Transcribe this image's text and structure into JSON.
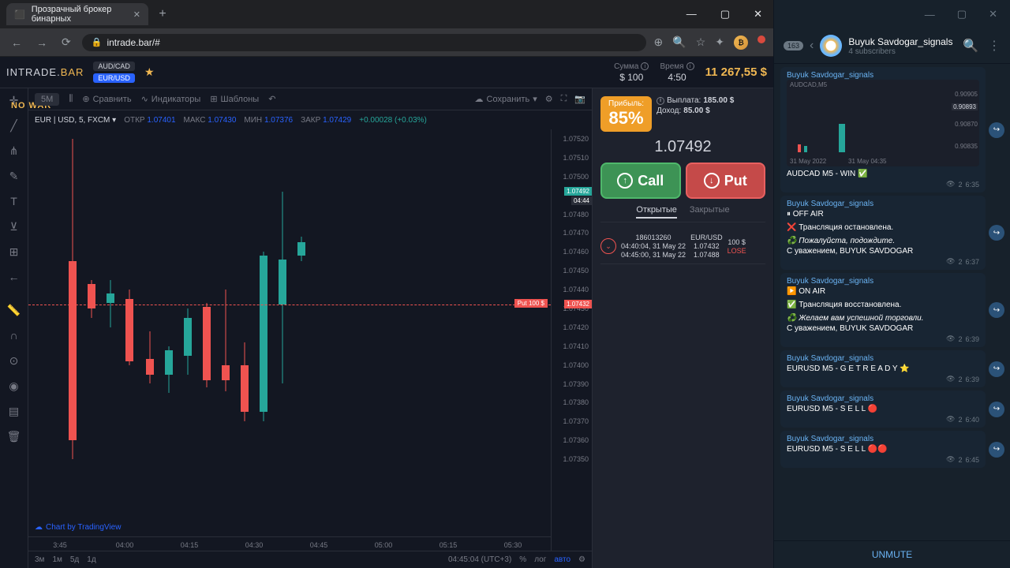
{
  "browser": {
    "tab_title": "Прозрачный брокер бинарных",
    "url": "intrade.bar/#"
  },
  "site": {
    "logo_a": "INTRADE",
    "logo_b": "BAR",
    "nowar": "NO WAR",
    "pairs": {
      "aud": "AUD/CAD",
      "eur": "EUR/USD"
    },
    "hdr": {
      "sum_lbl": "Сумма",
      "sum_val": "$   100",
      "time_lbl": "Время",
      "time_val": "4:50",
      "balance": "11 267,55 $"
    },
    "toolbar": {
      "tf": "5М",
      "compare": "Сравнить",
      "indicators": "Индикаторы",
      "templates": "Шаблоны",
      "save": "Сохранить"
    },
    "ticker": {
      "sym": "EUR | USD, 5, FXCM",
      "o_lbl": "ОТКР",
      "o": "1.07401",
      "h_lbl": "МАКС",
      "h": "1.07430",
      "l_lbl": "МИН",
      "l": "1.07376",
      "c_lbl": "ЗАКР",
      "c": "1.07429",
      "chg": "+0.00028 (+0.03%)"
    },
    "chart_footer": {
      "tf3m": "3м",
      "tf1m": "1м",
      "tf5d": "5д",
      "tf1d": "1д",
      "time": "04:45:04 (UTC+3)",
      "pct": "%",
      "log": "лог",
      "auto": "авто"
    },
    "tv_credit": "Chart by TradingView",
    "price_tags": {
      "cur": "1.07492",
      "mid": "04:44",
      "put_lbl": "Put",
      "put_amt": "100 $",
      "put_px": "1.07432"
    }
  },
  "chart_data": {
    "type": "candlestick",
    "symbol": "EUR/USD",
    "timeframe": "5m",
    "y_ticks": [
      "1.07520",
      "1.07510",
      "1.07500",
      "1.07480",
      "1.07470",
      "1.07460",
      "1.07450",
      "1.07440",
      "1.07430",
      "1.07420",
      "1.07410",
      "1.07400",
      "1.07390",
      "1.07380",
      "1.07370",
      "1.07360",
      "1.07350"
    ],
    "x_ticks": [
      "3:45",
      "04:00",
      "04:15",
      "04:30",
      "04:45",
      "05:00",
      "05:15",
      "05:30"
    ],
    "candles": [
      {
        "x": 48,
        "o": 1.07455,
        "h": 1.0752,
        "l": 1.0735,
        "c": 1.0736,
        "dir": "red"
      },
      {
        "x": 72,
        "o": 1.07443,
        "h": 1.07445,
        "l": 1.07425,
        "c": 1.0743,
        "dir": "red"
      },
      {
        "x": 96,
        "o": 1.07433,
        "h": 1.07445,
        "l": 1.0742,
        "c": 1.07438,
        "dir": "green"
      },
      {
        "x": 120,
        "o": 1.07435,
        "h": 1.0744,
        "l": 1.074,
        "c": 1.07402,
        "dir": "red"
      },
      {
        "x": 146,
        "o": 1.07403,
        "h": 1.07418,
        "l": 1.0739,
        "c": 1.07395,
        "dir": "red"
      },
      {
        "x": 170,
        "o": 1.07395,
        "h": 1.0741,
        "l": 1.07385,
        "c": 1.07408,
        "dir": "green"
      },
      {
        "x": 194,
        "o": 1.07405,
        "h": 1.0743,
        "l": 1.07395,
        "c": 1.07425,
        "dir": "green"
      },
      {
        "x": 218,
        "o": 1.07431,
        "h": 1.07433,
        "l": 1.07388,
        "c": 1.07392,
        "dir": "red"
      },
      {
        "x": 242,
        "o": 1.07392,
        "h": 1.0744,
        "l": 1.07386,
        "c": 1.074,
        "dir": "red"
      },
      {
        "x": 266,
        "o": 1.074,
        "h": 1.07412,
        "l": 1.0737,
        "c": 1.07375,
        "dir": "red"
      },
      {
        "x": 290,
        "o": 1.07375,
        "h": 1.0746,
        "l": 1.0737,
        "c": 1.07458,
        "dir": "green"
      },
      {
        "x": 314,
        "o": 1.07456,
        "h": 1.07492,
        "l": 1.0739,
        "c": 1.07432,
        "dir": "green"
      },
      {
        "x": 338,
        "o": 1.07458,
        "h": 1.07468,
        "l": 1.07455,
        "c": 1.07465,
        "dir": "green"
      }
    ],
    "ylim": [
      1.07345,
      1.07525
    ],
    "put_line": 1.07432,
    "current_price": 1.07492
  },
  "trade": {
    "profit_lbl": "Прибыль:",
    "profit_pct": "85%",
    "payout_lbl": "Выплата:",
    "payout_val": "185.00 $",
    "income_lbl": "Доход:",
    "income_val": "85.00 $",
    "quote": "1.07492",
    "call": "Call",
    "put": "Put",
    "tab_open": "Открытые",
    "tab_closed": "Закрытые",
    "position": {
      "id": "186013260",
      "t1": "04:40:04, 31 May 22",
      "t2": "04:45:00, 31 May 22",
      "pair": "EUR/USD",
      "p1": "1.07432",
      "p2": "1.07488",
      "amt": "100 $",
      "res": "LOSE"
    }
  },
  "telegram": {
    "badge": "163",
    "channel": "Buyuk Savdogar_signals",
    "subs": "4 subscribers",
    "unmute": "UNMUTE",
    "mini": {
      "sym": "AUDCAD,M5",
      "date1": "31 May 2022",
      "date2": "31 May 04:35",
      "p1": "0.90905",
      "p2": "0.90893",
      "p3": "0.90870",
      "p4": "0.90835"
    },
    "msgs": [
      {
        "sender": "Buyuk Savdogar_signals",
        "body1": "AUDCAD M5 - WIN ✅",
        "t": "6:35",
        "views": "2"
      },
      {
        "sender": "Buyuk Savdogar_signals",
        "body1": "⏸ OFF AIR",
        "body2": "❌ Трансляция остановлена.",
        "body3": "♻️ Пожалуйста, подождите.",
        "body4": "С уважением, BUYUK SAVDOGAR",
        "t": "6:37",
        "views": "2"
      },
      {
        "sender": "Buyuk Savdogar_signals",
        "body1": "▶️ ON AIR",
        "body2": "✅ Трансляция восстановлена.",
        "body3": "♻️ Желаем вам успешной торговли.",
        "body4": "С уважением, BUYUK SAVDOGAR",
        "t": "6:39",
        "views": "2"
      },
      {
        "sender": "Buyuk Savdogar_signals",
        "body1": "EURUSD M5 - G E T  R E A D Y ⭐",
        "t": "6:39",
        "views": "2"
      },
      {
        "sender": "Buyuk Savdogar_signals",
        "body1": "EURUSD M5 - S E L L 🔴",
        "t": "6:40",
        "views": "2"
      },
      {
        "sender": "Buyuk Savdogar_signals",
        "body1": "EURUSD M5 - S E L L 🔴🔴",
        "t": "6:45",
        "views": "2"
      }
    ]
  }
}
